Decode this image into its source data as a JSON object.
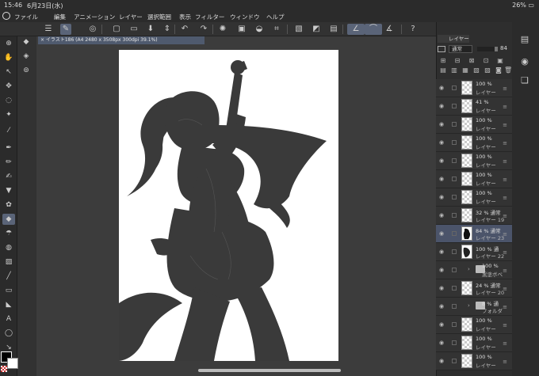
{
  "status": {
    "time": "15:46",
    "date": "6月23日(水)",
    "battery": "26%"
  },
  "menu": [
    "ファイル",
    "編集",
    "アニメーション",
    "レイヤー",
    "選択範囲",
    "表示",
    "フィルター",
    "ウィンドウ",
    "ヘルプ"
  ],
  "document": {
    "tab_label": "× イラスト186 (A4 2480 x 3508px 300dpi 39.1%)"
  },
  "layer_panel": {
    "tab_label": "レイヤー",
    "blend_mode": "通常",
    "opacity": "84"
  },
  "layers": [
    {
      "pct": "100 %",
      "name": "レイヤー",
      "kind": "raster",
      "indent": 0
    },
    {
      "pct": "41 %",
      "name": "レイヤー",
      "kind": "raster",
      "indent": 0
    },
    {
      "pct": "100 %",
      "name": "レイヤー",
      "kind": "raster",
      "indent": 0
    },
    {
      "pct": "100 %",
      "name": "レイヤー",
      "kind": "raster",
      "indent": 0
    },
    {
      "pct": "100 %",
      "name": "レイヤー",
      "kind": "raster",
      "indent": 0
    },
    {
      "pct": "100 %",
      "name": "レイヤー",
      "kind": "raster",
      "indent": 0
    },
    {
      "pct": "100 %",
      "name": "レイヤー",
      "kind": "raster",
      "indent": 0
    },
    {
      "pct": "32 %  通常",
      "name": "レイヤー 19",
      "kind": "raster",
      "indent": 0
    },
    {
      "pct": "84 %  通常",
      "name": "レイヤー 23",
      "kind": "silhouette",
      "indent": 0,
      "selected": true
    },
    {
      "pct": "100 %  通",
      "name": "レイヤー 22",
      "kind": "silhouette2",
      "indent": 0
    },
    {
      "pct": "100 %",
      "name": "黒塗ボベ",
      "kind": "folder",
      "indent": 1
    },
    {
      "pct": "24 %  通常",
      "name": "レイヤー 20",
      "kind": "raster",
      "indent": 0
    },
    {
      "pct": "8 %  通",
      "name": "フォルダ",
      "kind": "folder",
      "indent": 1
    },
    {
      "pct": "100 %",
      "name": "レイヤー",
      "kind": "raster",
      "indent": 0
    },
    {
      "pct": "100 %",
      "name": "レイヤー",
      "kind": "raster",
      "indent": 0
    },
    {
      "pct": "100 %",
      "name": "レイヤー",
      "kind": "raster",
      "indent": 0
    }
  ],
  "colors": {
    "main": "#000000",
    "sub": "#ffffff",
    "accent": "#5a6478"
  }
}
